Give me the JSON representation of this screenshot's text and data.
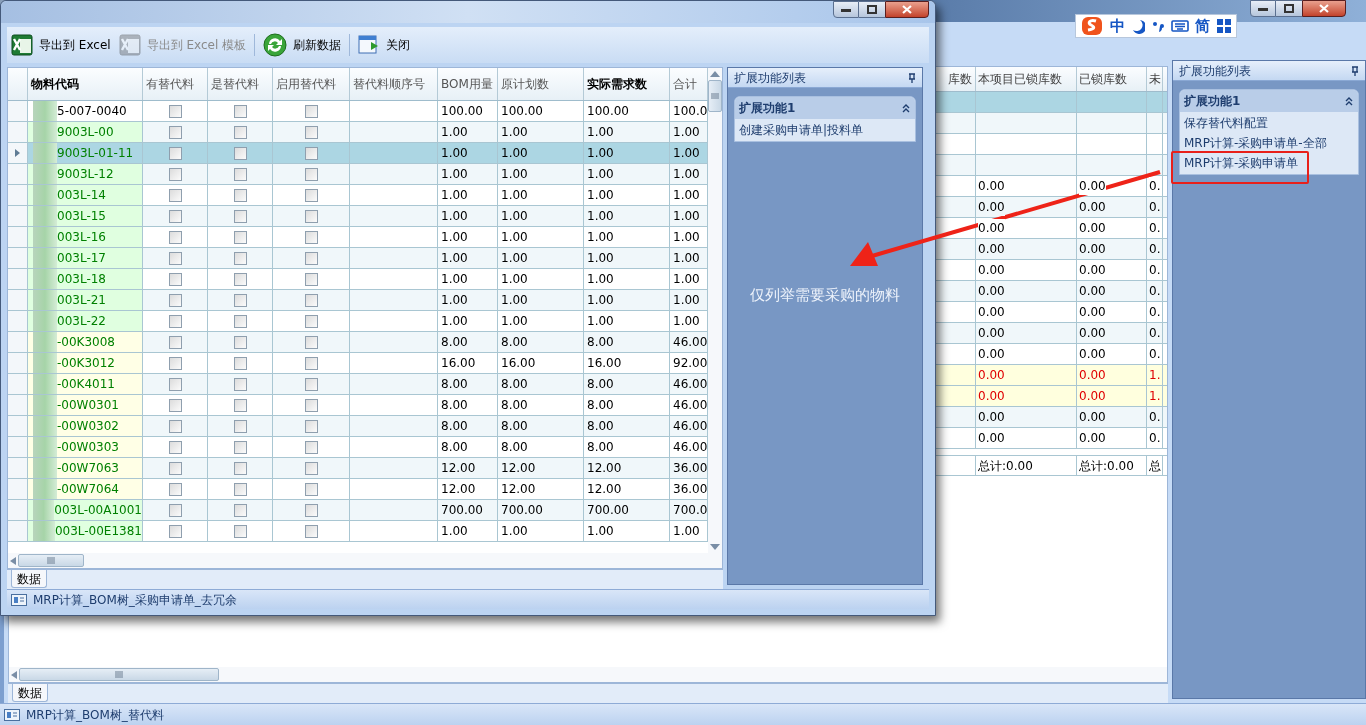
{
  "ime_toolbar": {
    "items": [
      {
        "kind": "logo"
      },
      {
        "kind": "text",
        "label": "中"
      },
      {
        "kind": "moon"
      },
      {
        "kind": "punct"
      },
      {
        "kind": "keyboard"
      },
      {
        "kind": "text",
        "label": "简"
      },
      {
        "kind": "grid"
      }
    ]
  },
  "main": {
    "table": {
      "columns": [
        "库数",
        "本项目已锁库数",
        "已锁库数",
        "未"
      ],
      "rows": [
        {
          "selected": true,
          "alert": false
        },
        {
          "selected": false,
          "alert": false
        },
        {
          "selected": false,
          "alert": false
        },
        {
          "selected": false,
          "alert": false
        },
        {
          "selected": false,
          "alert": false,
          "cells": [
            "0.00",
            "0.00",
            "0."
          ]
        },
        {
          "selected": false,
          "alert": false,
          "cells": [
            "0.00",
            "0.00",
            "0."
          ]
        },
        {
          "selected": false,
          "alert": false,
          "cells": [
            "0.00",
            "0.00",
            "0."
          ]
        },
        {
          "selected": false,
          "alert": false,
          "cells": [
            "0.00",
            "0.00",
            "0."
          ]
        },
        {
          "selected": false,
          "alert": false,
          "cells": [
            "0.00",
            "0.00",
            "0."
          ]
        },
        {
          "selected": false,
          "alert": false,
          "cells": [
            "0.00",
            "0.00",
            "0."
          ]
        },
        {
          "selected": false,
          "alert": false,
          "cells": [
            "0.00",
            "0.00",
            "0."
          ]
        },
        {
          "selected": false,
          "alert": false,
          "cells": [
            "0.00",
            "0.00",
            "0."
          ]
        },
        {
          "selected": false,
          "alert": false,
          "cells": [
            "0.00",
            "0.00",
            "0."
          ]
        },
        {
          "selected": false,
          "alert": true,
          "cells": [
            "0.00",
            "0.00",
            "1."
          ]
        },
        {
          "selected": false,
          "alert": true,
          "cells": [
            "0.00",
            "0.00",
            "1."
          ]
        },
        {
          "selected": false,
          "alert": false,
          "cells": [
            "0.00",
            "0.00",
            "0."
          ]
        },
        {
          "selected": false,
          "alert": false,
          "cells": [
            "0.00",
            "0.00",
            "0."
          ]
        }
      ],
      "totals": [
        "总计:0.00",
        "总计:0.00",
        "总"
      ]
    },
    "tabs": [
      {
        "label": "数据",
        "selected": true
      }
    ],
    "extension_panel": {
      "title": "扩展功能列表",
      "group": {
        "title": "扩展功能1",
        "expanded": true,
        "items": [
          "保存替代料配置",
          "MRP计算-采购申请单-全部",
          "MRP计算-采购申请单"
        ]
      }
    },
    "status_bar": "MRP计算_BOM树_替代料"
  },
  "dialog": {
    "toolbar": [
      {
        "kind": "excel",
        "label": "导出到 Excel",
        "disabled": false
      },
      {
        "kind": "excel",
        "label": "导出到 Excel 模板",
        "disabled": true
      },
      {
        "kind": "refresh",
        "label": "刷新数据",
        "disabled": false
      },
      {
        "kind": "close",
        "label": "关闭",
        "disabled": false
      }
    ],
    "table": {
      "columns": [
        {
          "label": "物料代码",
          "bold": true
        },
        {
          "label": "有替代料",
          "bold": false
        },
        {
          "label": "是替代料",
          "bold": false
        },
        {
          "label": "启用替代料",
          "bold": false
        },
        {
          "label": "替代料顺序号",
          "bold": false
        },
        {
          "label": "BOM用量",
          "bold": false
        },
        {
          "label": "原计划数",
          "bold": false
        },
        {
          "label": "实际需求数",
          "bold": true
        },
        {
          "label": "合计",
          "bold": false
        }
      ],
      "rows": [
        {
          "code": "5-007-0040",
          "kind": "plain",
          "selected": false,
          "checks": [
            false,
            false,
            false
          ],
          "values": [
            "100.00",
            "100.00",
            "100.00",
            "100.0"
          ]
        },
        {
          "code": "9003L-00",
          "kind": "green",
          "selected": false,
          "checks": [
            false,
            false,
            false
          ],
          "values": [
            "1.00",
            "1.00",
            "1.00",
            "1.00"
          ]
        },
        {
          "code": "9003L-01-11",
          "kind": "green",
          "selected": true,
          "checks": [
            false,
            false,
            false
          ],
          "values": [
            "1.00",
            "1.00",
            "1.00",
            "1.00"
          ]
        },
        {
          "code": "9003L-12",
          "kind": "green",
          "selected": false,
          "checks": [
            false,
            false,
            false
          ],
          "values": [
            "1.00",
            "1.00",
            "1.00",
            "1.00"
          ]
        },
        {
          "code": "003L-14",
          "kind": "green",
          "selected": false,
          "checks": [
            false,
            false,
            false
          ],
          "values": [
            "1.00",
            "1.00",
            "1.00",
            "1.00"
          ]
        },
        {
          "code": "003L-15",
          "kind": "green",
          "selected": false,
          "checks": [
            false,
            false,
            false
          ],
          "values": [
            "1.00",
            "1.00",
            "1.00",
            "1.00"
          ]
        },
        {
          "code": "003L-16",
          "kind": "green",
          "selected": false,
          "checks": [
            false,
            false,
            false
          ],
          "values": [
            "1.00",
            "1.00",
            "1.00",
            "1.00"
          ]
        },
        {
          "code": "003L-17",
          "kind": "green",
          "selected": false,
          "checks": [
            false,
            false,
            false
          ],
          "values": [
            "1.00",
            "1.00",
            "1.00",
            "1.00"
          ]
        },
        {
          "code": "003L-18",
          "kind": "green",
          "selected": false,
          "checks": [
            false,
            false,
            false
          ],
          "values": [
            "1.00",
            "1.00",
            "1.00",
            "1.00"
          ]
        },
        {
          "code": "003L-21",
          "kind": "green",
          "selected": false,
          "checks": [
            false,
            false,
            false
          ],
          "values": [
            "1.00",
            "1.00",
            "1.00",
            "1.00"
          ]
        },
        {
          "code": "003L-22",
          "kind": "green",
          "selected": false,
          "checks": [
            false,
            false,
            false
          ],
          "values": [
            "1.00",
            "1.00",
            "1.00",
            "1.00"
          ]
        },
        {
          "code": "-00K3008",
          "kind": "yellow",
          "selected": false,
          "checks": [
            false,
            false,
            false
          ],
          "values": [
            "8.00",
            "8.00",
            "8.00",
            "46.00"
          ]
        },
        {
          "code": "-00K3012",
          "kind": "yellow",
          "selected": false,
          "checks": [
            false,
            false,
            false
          ],
          "values": [
            "16.00",
            "16.00",
            "16.00",
            "92.00"
          ]
        },
        {
          "code": "-00K4011",
          "kind": "yellow",
          "selected": false,
          "checks": [
            false,
            false,
            false
          ],
          "values": [
            "8.00",
            "8.00",
            "8.00",
            "46.00"
          ]
        },
        {
          "code": "-00W0301",
          "kind": "yellow",
          "selected": false,
          "checks": [
            false,
            false,
            false
          ],
          "values": [
            "8.00",
            "8.00",
            "8.00",
            "46.00"
          ]
        },
        {
          "code": "-00W0302",
          "kind": "yellow",
          "selected": false,
          "checks": [
            false,
            false,
            false
          ],
          "values": [
            "8.00",
            "8.00",
            "8.00",
            "46.00"
          ]
        },
        {
          "code": "-00W0303",
          "kind": "yellow",
          "selected": false,
          "checks": [
            false,
            false,
            false
          ],
          "values": [
            "8.00",
            "8.00",
            "8.00",
            "46.00"
          ]
        },
        {
          "code": "-00W7063",
          "kind": "yellow",
          "selected": false,
          "checks": [
            false,
            false,
            false
          ],
          "values": [
            "12.00",
            "12.00",
            "12.00",
            "36.00"
          ]
        },
        {
          "code": "-00W7064",
          "kind": "yellow",
          "selected": false,
          "checks": [
            false,
            false,
            false
          ],
          "values": [
            "12.00",
            "12.00",
            "12.00",
            "36.00"
          ]
        },
        {
          "code": "003L-00A1001",
          "kind": "green",
          "selected": false,
          "checks": [
            false,
            false,
            false
          ],
          "values": [
            "700.00",
            "700.00",
            "700.00",
            "700.0"
          ]
        },
        {
          "code": "003L-00E1381",
          "kind": "green",
          "selected": false,
          "checks": [
            false,
            false,
            false
          ],
          "values": [
            "1.00",
            "1.00",
            "1.00",
            "1.00"
          ]
        }
      ]
    },
    "tabs": [
      {
        "label": "数据",
        "selected": true
      }
    ],
    "extension_panel": {
      "title": "扩展功能列表",
      "group": {
        "title": "扩展功能1",
        "expanded": true,
        "items": [
          "创建采购申请单|投料单"
        ]
      }
    },
    "status_bar": "MRP计算_BOM树_采购申请单_去冗余"
  },
  "annotation": {
    "text": "仅列举需要采购的物料"
  }
}
